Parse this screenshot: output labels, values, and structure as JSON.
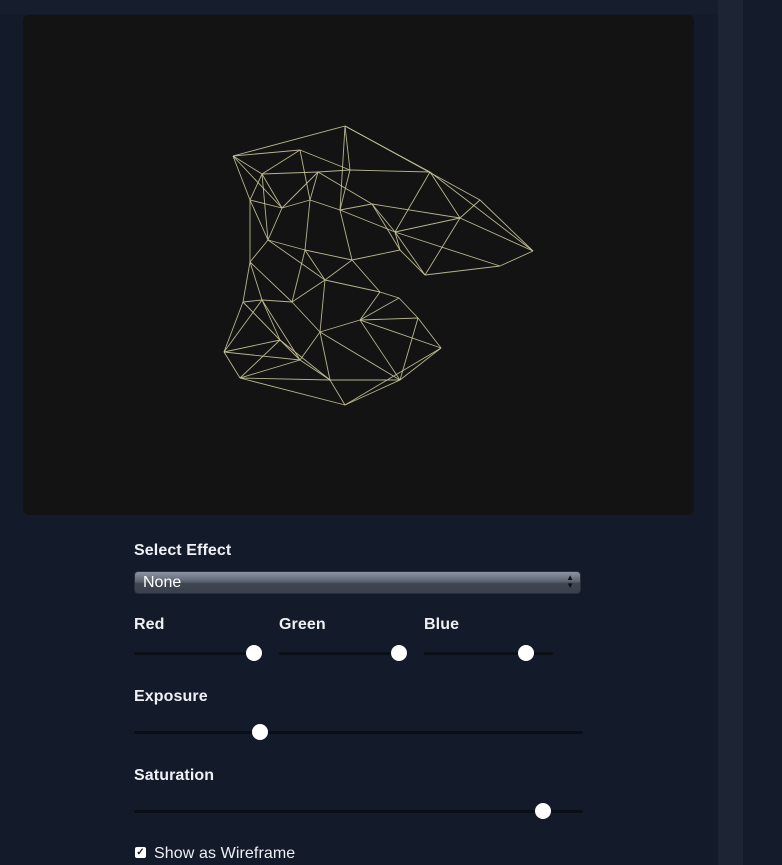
{
  "viewer": {
    "background": "#131313",
    "wire_color": "#c9c79c"
  },
  "controls": {
    "effect_label": "Select Effect",
    "effect_value": "None",
    "red_label": "Red",
    "green_label": "Green",
    "blue_label": "Blue",
    "red_value": 0.93,
    "green_value": 0.93,
    "blue_value": 0.79,
    "exposure_label": "Exposure",
    "exposure_value": 0.28,
    "saturation_label": "Saturation",
    "saturation_value": 0.91,
    "wireframe_label": "Show as Wireframe",
    "wireframe_checked": true
  }
}
